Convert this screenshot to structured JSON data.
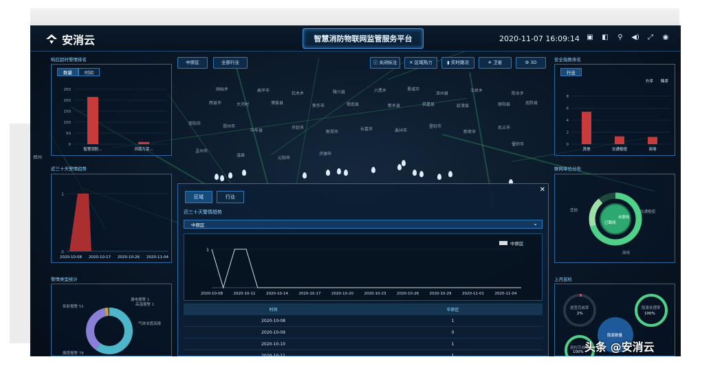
{
  "brand": {
    "name": "安消云"
  },
  "header": {
    "title": "智慧消防物联网监管服务平台",
    "datetime": "2020-11-07 16:09:14"
  },
  "top_icons": [
    "monitor-icon",
    "layers-icon",
    "location-icon",
    "volume-icon",
    "fullscreen-icon",
    "user-icon"
  ],
  "map_controls": {
    "left_buttons": [
      "中原区",
      "全部行业"
    ],
    "right_buttons": [
      "关闭标注",
      "区域热力",
      "实时路况",
      "卫星",
      "3D"
    ]
  },
  "left_panel_1": {
    "title": "响应超时警情排名",
    "tabs": [
      "数量",
      "时间"
    ],
    "y_ticks": [
      "250",
      "200",
      "150",
      "100",
      "50",
      "0"
    ],
    "categories": [
      "智慧消防...",
      "河南万变..."
    ],
    "values": [
      215,
      10
    ]
  },
  "left_panel_2": {
    "title": "近三十天警情趋势",
    "y_ticks": [
      "1",
      "0"
    ],
    "x_ticks": [
      "2020-10-08",
      "2020-10-17",
      "2020-10-26",
      "2020-11-04"
    ]
  },
  "left_panel_3": {
    "title": "警情类型统计",
    "labels": [
      "漏电报警 1",
      "高温报警 1",
      "气体浓度高报",
      "拆卸报警 51",
      "烟感报警 78"
    ]
  },
  "right_panel_1": {
    "title": "安全指数排名",
    "tab": "行业",
    "sort_labels": [
      "升序",
      "降序"
    ],
    "y_ticks": [
      "8",
      "6",
      "4",
      "2",
      "0"
    ],
    "categories": [
      "其他",
      "交通枢纽",
      "商场"
    ],
    "values": [
      5.4,
      1.3,
      1.2
    ]
  },
  "right_panel_2": {
    "title": "联网单位分布",
    "center_label": "已联网",
    "center_label_2": "未联网",
    "labels": [
      "其他",
      "交通枢纽",
      "商场"
    ]
  },
  "right_panel_3": {
    "title": "上月巡检",
    "gauges": [
      {
        "label": "逐查完成率",
        "value": "2%"
      },
      {
        "label": "隐患处理率",
        "value": "100%"
      },
      {
        "label": "巡检完成率",
        "value": "100%"
      }
    ],
    "center": "隐患数量"
  },
  "left_side_labels": [
    "郑州",
    "近三十天警情趋势"
  ],
  "modal": {
    "tabs": [
      "区域",
      "行业"
    ],
    "subtitle": "近三十天警情趋势",
    "select_value": "中原区",
    "legend": "中原区",
    "table_headers": [
      "时间",
      "中原区"
    ],
    "rows": [
      [
        "2020-10-08",
        "1"
      ],
      [
        "2020-10-09",
        "0"
      ],
      [
        "2020-10-10",
        "1"
      ],
      [
        "2020-10-11",
        "1"
      ]
    ]
  },
  "chart_data": {
    "type": "line",
    "title": "近三十天警情趋势",
    "series": [
      {
        "name": "中原区",
        "values": [
          1,
          0,
          1,
          1,
          0,
          0,
          0,
          0,
          0,
          0,
          0,
          0,
          0,
          0,
          0,
          0,
          0,
          0,
          0,
          0,
          0,
          0,
          0,
          0,
          0,
          0,
          0,
          0
        ]
      }
    ],
    "x": [
      "2020-10-08",
      "2020-10-11",
      "2020-10-14",
      "2020-10-17",
      "2020-10-20",
      "2020-10-23",
      "2020-10-26",
      "2020-10-29",
      "2020-11-01",
      "2020-11-04"
    ],
    "ylim": [
      0,
      1
    ]
  },
  "watermark": {
    "text": "头条 @安消云"
  },
  "map_labels": [
    "固始乡",
    "高平市",
    "石木乡",
    "陵川县",
    "六票乡",
    "晋城市",
    "泽州县",
    "王桥乡",
    "陈水乡",
    "辉县市",
    "大河村",
    "博爱县",
    "焦作市",
    "修武县",
    "新乡县",
    "获嘉县",
    "延津县",
    "原阳县",
    "武陟县",
    "荥阳市",
    "郑州市",
    "中牟县",
    "开封市",
    "新郑市",
    "长葛市",
    "禹州市",
    "登封市",
    "新密市",
    "巩义市",
    "偃师市",
    "孟州市",
    "温县",
    "沁阳市",
    "济源市"
  ],
  "colors": {
    "accent": "#3f8fd1",
    "bar": "#d23b3b",
    "ring_green": "#4fd18a"
  }
}
